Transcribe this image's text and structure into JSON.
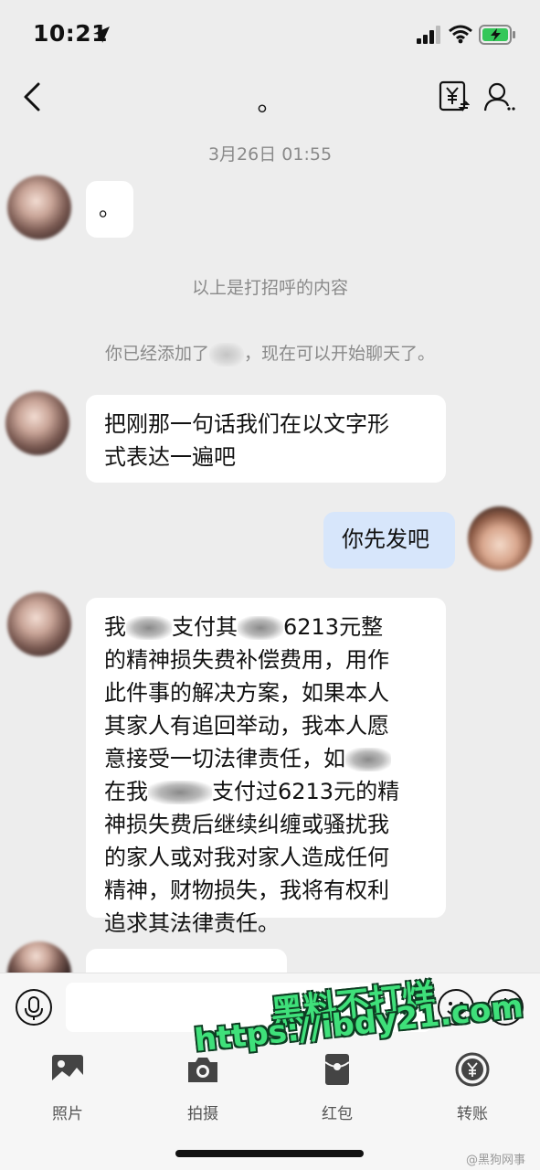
{
  "status_bar": {
    "time": "10:21"
  },
  "nav": {
    "title": "。"
  },
  "chat": {
    "timestamp": "3月26日 01:55",
    "first_message": "。",
    "system_greeting": "以上是打招呼的内容",
    "system_added_prefix": "你已经添加了",
    "system_added_suffix": "，现在可以开始聊天了。",
    "msg_request": [
      "把刚那一句话我们在以文字形",
      "式表达一遍吧"
    ],
    "msg_reply": "你先发吧",
    "statement": {
      "l1a": "我",
      "l1b": "支付其",
      "l1c": "6213元整",
      "l2": "的精神损失费补偿费用，用作",
      "l3": "此件事的解决方案，如果本人",
      "l4": "其家人有追回举动，我本人愿",
      "l5": "意接受一切法律责任，如",
      "l6a": "在我",
      "l6b": "支付过6213元的精",
      "l7": "神损失费后继续纠缠或骚扰我",
      "l8": "的家人或对我对家人造成任何",
      "l9": "精神，财物损失，我将有权利",
      "l10": "追求其法律责任。"
    }
  },
  "toolbar": {
    "items": [
      {
        "label": "照片",
        "icon": "photo-icon"
      },
      {
        "label": "拍摄",
        "icon": "camera-icon"
      },
      {
        "label": "红包",
        "icon": "red-packet-icon"
      },
      {
        "label": "转账",
        "icon": "transfer-yuan-icon"
      }
    ]
  },
  "watermark": {
    "line1": "黑料不打烊",
    "line2": "https://ibdy21.com",
    "credit": "@黑狗网事"
  },
  "colors": {
    "background": "#ededed",
    "my_bubble": "#d7e6fb",
    "watermark_green": "#3fe07a"
  }
}
